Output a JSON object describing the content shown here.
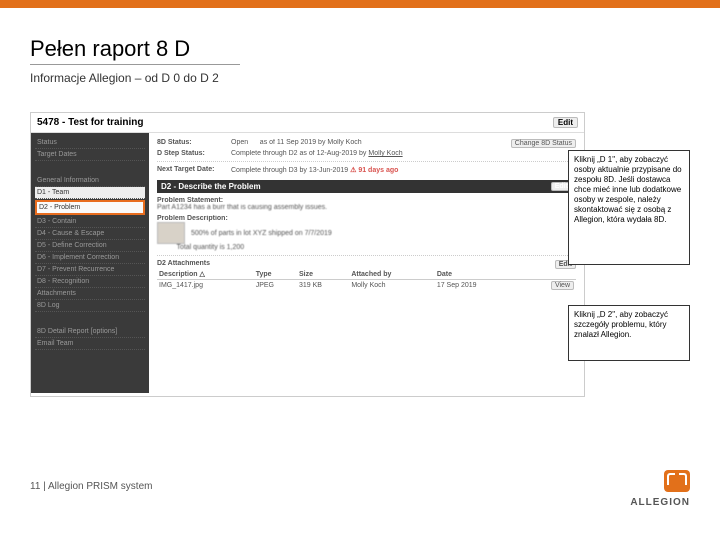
{
  "slide": {
    "title": "Pełen raport 8 D",
    "subtitle": "Informacje Allegion – od D 0 do D 2",
    "footer": "11 | Allegion PRISM system",
    "logo_text": "ALLEGION"
  },
  "callouts": {
    "d1": "Kliknij „D 1\", aby zobaczyć osoby aktualnie przypisane do zespołu 8D. Jeśli dostawca chce mieć inne lub dodatkowe osoby w zespole, należy skontaktować się z osobą z Allegion, która wydała 8D.",
    "d2": "Kliknij „D 2\", aby zobaczyć szczegóły problemu, który znalazł Allegion."
  },
  "screenshot": {
    "header": {
      "title": "5478 - Test for training",
      "edit": "Edit"
    },
    "left_nav": {
      "status": "Status",
      "target": "Target Dates",
      "general": "General Information",
      "d1": "D1 - Team",
      "d2": "D2 - Problem",
      "d3": "D3 - Contain",
      "d4": "D4 - Cause & Escape",
      "d5": "D5 - Define Correction",
      "d6": "D6 - Implement Correction",
      "d7": "D7 - Prevent Recurrence",
      "d8": "D8 - Recognition",
      "attachments": "Attachments",
      "log": "8D Log",
      "detail": "8D Detail Report    [options]",
      "email": "Email Team"
    },
    "status": {
      "status_label": "8D Status:",
      "status_val": "Open",
      "status_date": "as of 11 Sep 2019 by Molly Koch",
      "change_btn": "Change 8D Status",
      "step_label": "D Step Status:",
      "step_val": "Complete through D2  as of 12-Aug-2019 by",
      "step_link": "Molly Koch",
      "next_label": "Next Target Date:",
      "next_val": "Complete through D3 by 13-Jun-2019",
      "next_warn": "⚠ 91 days ago"
    },
    "d2_section": {
      "title": "D2 - Describe the Problem",
      "edit": "Edit",
      "ps_label": "Problem Statement:",
      "ps_val": "Part A1234 has a burr that is causing assembly issues.",
      "pd_label": "Problem Description:",
      "pd_val1": "500% of parts in lot XYZ shipped on 7/7/2019",
      "pd_val2": "Total quantity is 1,200"
    },
    "attachments": {
      "title": "D2 Attachments",
      "edit": "Edit",
      "cols": {
        "desc": "Description △",
        "type": "Type",
        "size": "Size",
        "by": "Attached by",
        "date": "Date"
      },
      "row": {
        "desc": "IMG_1417.jpg",
        "type": "JPEG",
        "size": "319 KB",
        "by": "Molly Koch",
        "date": "17 Sep 2019",
        "view": "View"
      }
    }
  }
}
